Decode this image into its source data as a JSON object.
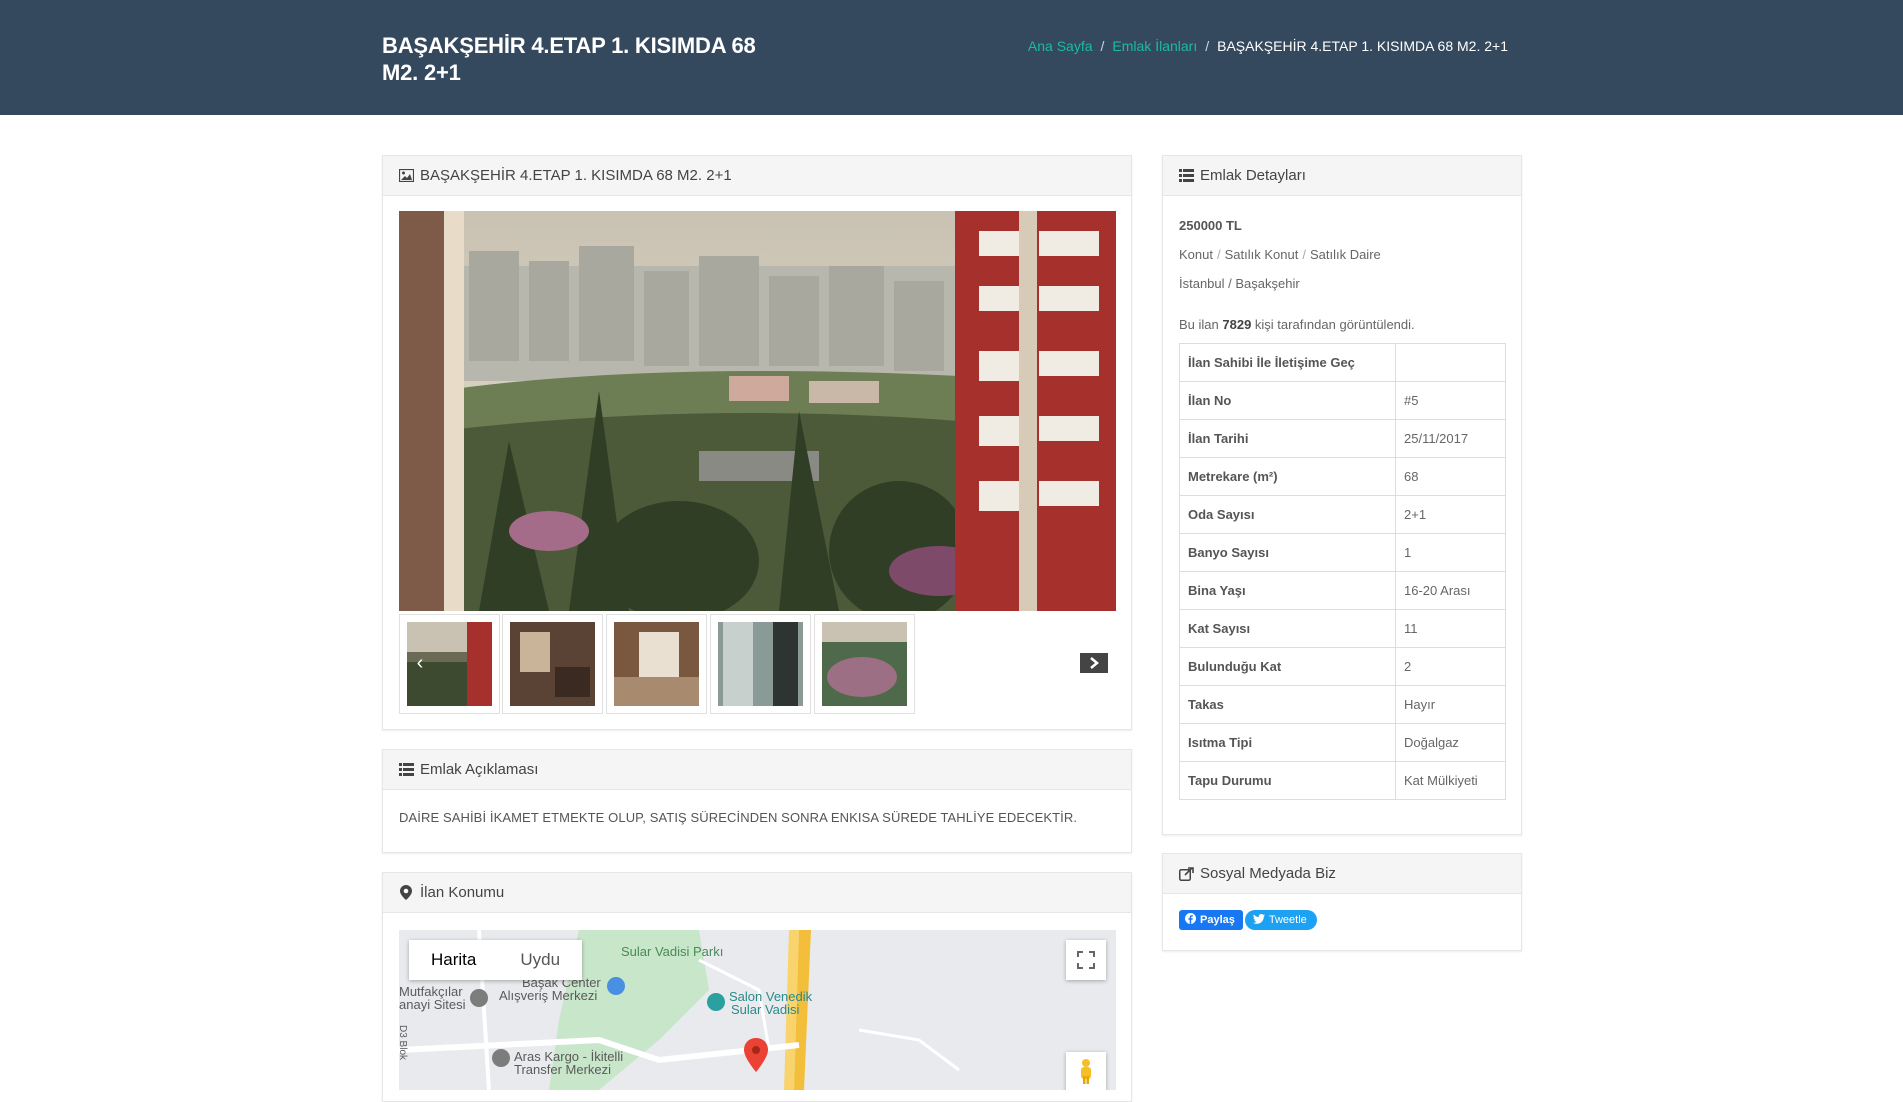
{
  "header": {
    "title": "BAŞAKŞEHİR 4.ETAP 1. KISIMDA 68 M2. 2+1",
    "breadcrumb": {
      "home": "Ana Sayfa",
      "listings": "Emlak İlanları",
      "current": "BAŞAKŞEHİR 4.ETAP 1. KISIMDA 68 M2. 2+1",
      "separator": "/"
    }
  },
  "gallery": {
    "heading": "BAŞAKŞEHİR 4.ETAP 1. KISIMDA 68 M2. 2+1",
    "icon": "image-icon",
    "thumbnail_count": 5
  },
  "description": {
    "heading": "Emlak Açıklaması",
    "text": "DAİRE SAHİBİ İKAMET ETMEKTE OLUP, SATIŞ SÜRECİNDEN SONRA ENKISA SÜREDE TAHLİYE EDECEKTİR."
  },
  "location": {
    "heading": "İlan Konumu",
    "map_types": [
      "Harita",
      "Uydu"
    ],
    "active_map_type": "Harita",
    "labels": {
      "park": "Sular Vadisi Parkı",
      "mall_line1": "Başak Center",
      "mall_line2": "Alışveriş Merkezi",
      "site_line1": "Mutfakçılar",
      "site_line2": "anayi Sitesi",
      "salon_line1": "Salon Venedik",
      "salon_line2": "Sular Vadisi",
      "cargo_line1": "Aras Kargo - İkitelli",
      "cargo_line2": "Transfer Merkezi",
      "road": "D3 Blok"
    }
  },
  "details": {
    "heading": "Emlak Detayları",
    "price": "250000 TL",
    "category": [
      "Konut",
      "Satılık Konut",
      "Satılık Daire"
    ],
    "category_sep": "/",
    "location": "İstanbul / Başakşehir",
    "views_prefix": "Bu ilan",
    "views_count": "7829",
    "views_suffix": "kişi tarafından görüntülendi.",
    "table": [
      {
        "key": "İlan Sahibi İle İletişime Geç",
        "value": ""
      },
      {
        "key": "İlan No",
        "value": "#5"
      },
      {
        "key": "İlan Tarihi",
        "value": "25/11/2017"
      },
      {
        "key": "Metrekare (m²)",
        "value": "68"
      },
      {
        "key": "Oda Sayısı",
        "value": "2+1"
      },
      {
        "key": "Banyo Sayısı",
        "value": "1"
      },
      {
        "key": "Bina Yaşı",
        "value": "16-20 Arası"
      },
      {
        "key": "Kat Sayısı",
        "value": "11"
      },
      {
        "key": "Bulunduğu Kat",
        "value": "2"
      },
      {
        "key": "Takas",
        "value": "Hayır"
      },
      {
        "key": "Isıtma Tipi",
        "value": "Doğalgaz"
      },
      {
        "key": "Tapu Durumu",
        "value": "Kat Mülkiyeti"
      }
    ]
  },
  "social": {
    "heading": "Sosyal Medyada Biz",
    "facebook_label": "Paylaş",
    "twitter_label": "Tweetle"
  },
  "colors": {
    "header_bg": "#35495e",
    "link": "#1abc9c",
    "facebook": "#1877f2",
    "twitter": "#1da1f2"
  }
}
